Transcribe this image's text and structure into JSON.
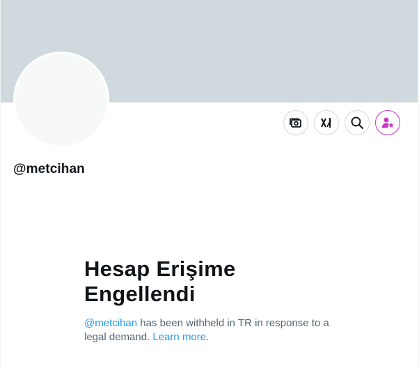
{
  "profile": {
    "handle": "@metcihan"
  },
  "actions": [
    {
      "name": "premium-gift-icon"
    },
    {
      "name": "grok-icon"
    },
    {
      "name": "search-icon"
    },
    {
      "name": "subscribe-person-star-icon"
    }
  ],
  "withheld": {
    "title_line1": "Hesap Erişime",
    "title_line2": "Engellendi",
    "mention": "@metcihan",
    "message": " has been withheld in TR in response to a legal demand. ",
    "learn_more": "Learn more",
    "period": "."
  },
  "colors": {
    "banner": "#cfd9de",
    "accent_link": "#1d9bf0",
    "subscribe_accent": "#c936cc"
  }
}
